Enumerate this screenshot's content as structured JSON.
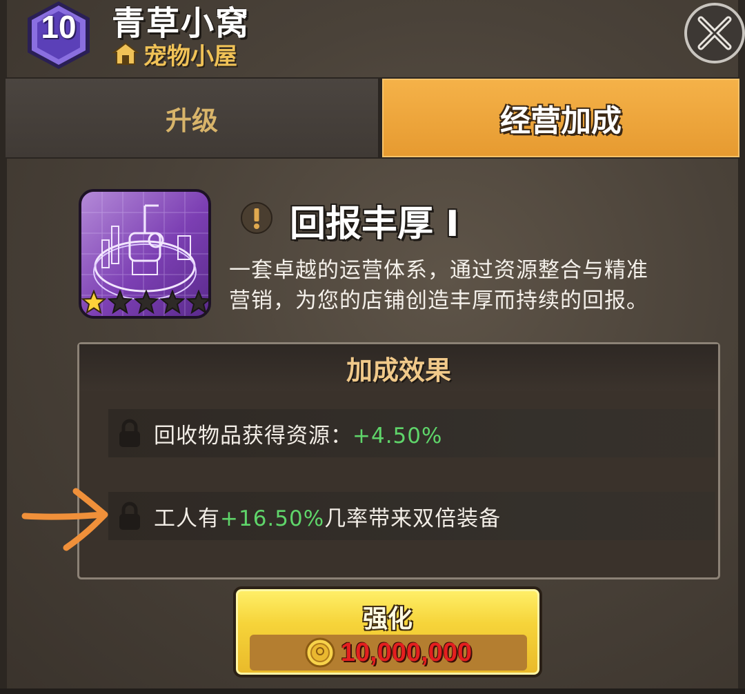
{
  "header": {
    "level": "10",
    "title": "青草小窝",
    "subtitle": "宠物小屋"
  },
  "tabs": [
    {
      "label": "升级",
      "active": false
    },
    {
      "label": "经营加成",
      "active": true
    }
  ],
  "skill": {
    "name": "回报丰厚 Ⅰ",
    "desc_line1": "一套卓越的运营体系，通过资源整合与精准",
    "desc_line2": "营销，为您的店铺创造丰厚而持续的回报。",
    "stars_filled": 1,
    "stars_total": 5
  },
  "effects": {
    "header": "加成效果",
    "rows": [
      {
        "prefix": "回收物品获得资源：",
        "value": "+4.50%",
        "suffix": ""
      },
      {
        "prefix": "工人有",
        "value": "+16.50%",
        "suffix": "几率带来双倍装备"
      }
    ]
  },
  "upgrade_button": {
    "label": "强化",
    "cost": "10,000,000"
  },
  "colors": {
    "accent_tab": "#f0a63a",
    "positive": "#5fd56a",
    "cost": "#e41f1f",
    "annotation_arrow": "#f0903a"
  },
  "icons": [
    "level-hexagon",
    "house-icon",
    "close-icon",
    "warning-icon",
    "star-icon",
    "lock-icon",
    "coin-icon"
  ]
}
